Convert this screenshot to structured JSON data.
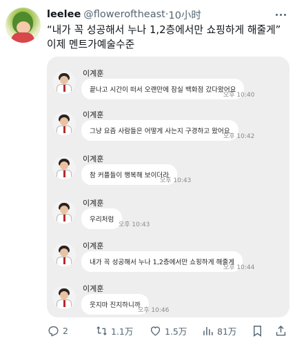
{
  "tweet": {
    "display_name": "leelee",
    "handle": "@floweroftheast",
    "separator": "·",
    "time": "10小时",
    "lines": [
      "“내가 꼭 성공해서 누나 1,2층에서만 쇼핑하게 해줄게”",
      "이제 멘트가예술수준"
    ]
  },
  "chat": {
    "messages": [
      {
        "sender": "이계훈",
        "text": "끝나고 시간이 떠서 오랜만에 잠실 백화점 갔다왔어요",
        "time": "오후 10:40"
      },
      {
        "sender": "이계훈",
        "text": "그냥 요즘 사람들은 어떻게 사는지 구경하고 왔어요",
        "time": "오후 10:42"
      },
      {
        "sender": "이계훈",
        "text": "참 커플들이 행복해 보이더라",
        "time": "오후 10:43"
      },
      {
        "sender": "이계훈",
        "text": "우리처럼",
        "time": "오후 10:43"
      },
      {
        "sender": "이계훈",
        "text": "내가 꼭 성공해서 누나 1,2층에서만 쇼핑하게 해줄게",
        "time": "오후 10:44"
      },
      {
        "sender": "이계훈",
        "text": "웃지마 진지하니까",
        "time": "오후 10:46"
      }
    ]
  },
  "actions": {
    "reply": {
      "icon": "reply-icon",
      "count": "2"
    },
    "retweet": {
      "icon": "retweet-icon",
      "count": "1.1万"
    },
    "like": {
      "icon": "heart-icon",
      "count": "1.5万"
    },
    "views": {
      "icon": "views-icon",
      "count": "81万"
    },
    "bookmark": {
      "icon": "bookmark-icon"
    },
    "share": {
      "icon": "share-icon"
    }
  }
}
